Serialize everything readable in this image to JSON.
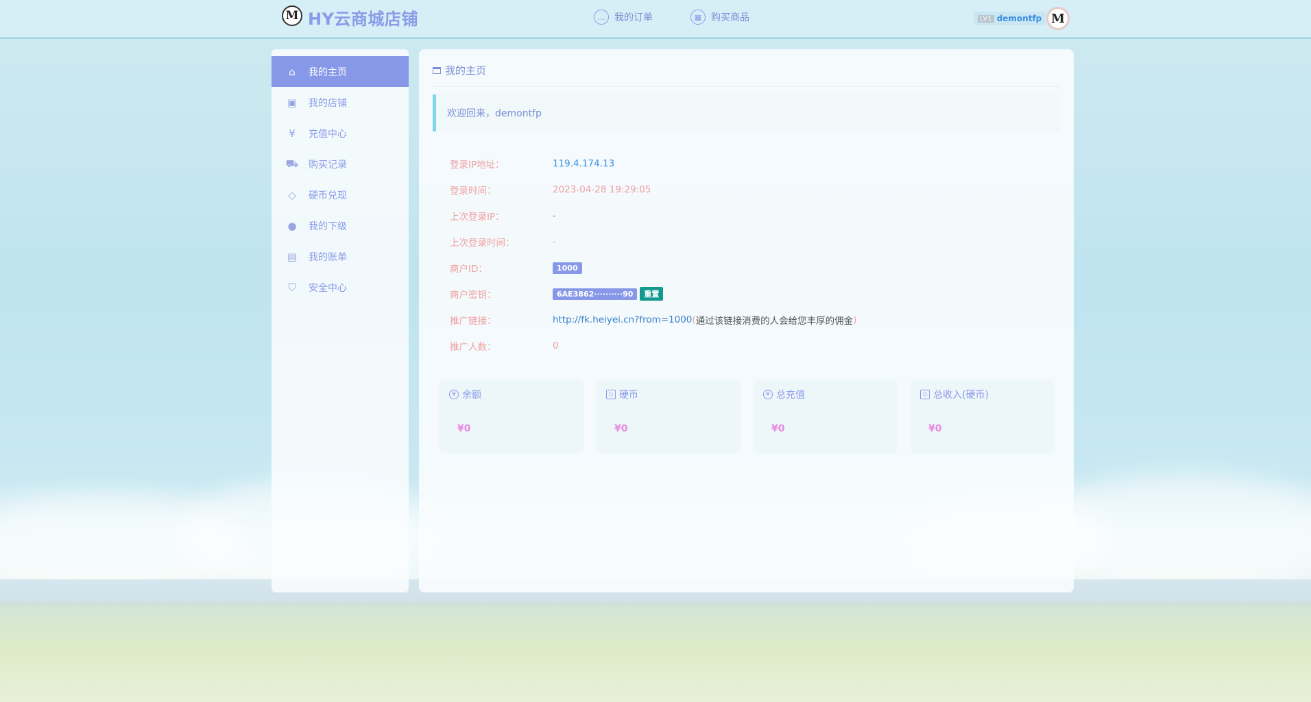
{
  "header": {
    "logo_letter": "M",
    "brand": "HY云商城店铺",
    "nav": [
      {
        "label": "我的订单",
        "icon": "chat-icon"
      },
      {
        "label": "购买商品",
        "icon": "shop-icon"
      }
    ],
    "user": {
      "level": "LV1",
      "name": "demontfp"
    },
    "avatar_letter": "M"
  },
  "sidebar": {
    "items": [
      {
        "label": "我的主页",
        "icon": "home-icon",
        "active": true
      },
      {
        "label": "我的店铺",
        "icon": "grid-icon"
      },
      {
        "label": "充值中心",
        "icon": "yen-icon"
      },
      {
        "label": "购买记录",
        "icon": "cart-icon"
      },
      {
        "label": "硬币兑现",
        "icon": "diamond-icon"
      },
      {
        "label": "我的下级",
        "icon": "user-icon"
      },
      {
        "label": "我的账单",
        "icon": "bill-icon"
      },
      {
        "label": "安全中心",
        "icon": "shield-icon"
      }
    ]
  },
  "main": {
    "title": "我的主页",
    "welcome": "欢迎回来，demontfp",
    "info": {
      "login_ip_label": "登录IP地址：",
      "login_ip": "119.4.174.13",
      "login_time_label": "登录时间：",
      "login_time": "2023-04-28 19:29:05",
      "last_ip_label": "上次登录IP：",
      "last_ip": "-",
      "last_time_label": "上次登录时间：",
      "last_time": "-",
      "merchant_id_label": "商户ID：",
      "merchant_id": "1000",
      "merchant_key_label": "商户密钥：",
      "merchant_key": "6AE3862··········90",
      "reset_label": "重置",
      "promo_link_label": "推广链接：",
      "promo_link": "http://fk.heiyei.cn?from=1000",
      "promo_hint_open": "(",
      "promo_hint": "通过该链接消费的人会给您丰厚的佣金",
      "promo_hint_close": ")",
      "promo_count_label": "推广人数：",
      "promo_count": "0"
    },
    "cards": [
      {
        "title": "余额",
        "value": "¥0",
        "icon": "yen-icon"
      },
      {
        "title": "硬币",
        "value": "¥0",
        "icon": "diamond-icon"
      },
      {
        "title": "总充值",
        "value": "¥0",
        "icon": "yen-icon"
      },
      {
        "title": "总收入(硬币)",
        "value": "¥0",
        "icon": "diamond-icon"
      }
    ]
  }
}
